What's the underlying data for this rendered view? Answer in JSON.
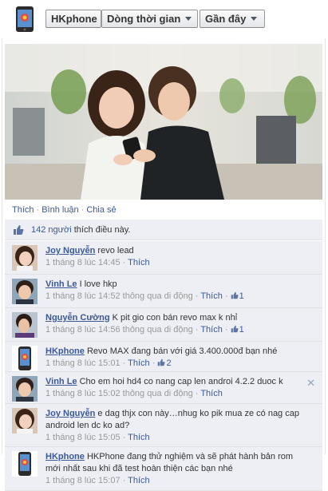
{
  "toolbar": {
    "page_name": "HKphone",
    "timeline_label": "Dòng thời gian",
    "recent_label": "Gần đây"
  },
  "post": {
    "actions": {
      "like": "Thích",
      "comment": "Bình luận",
      "share": "Chia sẻ",
      "separator": "·"
    },
    "likes": {
      "count_text": "142 người",
      "suffix": " thích điều này."
    }
  },
  "comments": [
    {
      "name": "Joy Nguyễn",
      "text": "revo lead",
      "time": "1 tháng 8 lúc 14:45",
      "via": "",
      "like_label": "Thích",
      "likes": ""
    },
    {
      "name": "Vinh Le",
      "text": "I love hkp",
      "time": "1 tháng 8 lúc 14:52",
      "via": "thông qua di động",
      "like_label": "Thích",
      "likes": "1"
    },
    {
      "name": "Nguyễn Cường",
      "text": "K pit gio con bán revo max k nhỉ",
      "time": "1 tháng 8 lúc 14:56",
      "via": "thông qua di động",
      "like_label": "Thích",
      "likes": "1"
    },
    {
      "name": "HKphone",
      "text": "Revo MAX đang bán với giá 3.400.000đ bạn nhé",
      "time": "1 tháng 8 lúc 15:01",
      "via": "",
      "like_label": "Thích",
      "likes": "2"
    },
    {
      "name": "Vinh Le",
      "text": "Cho em hoi hd4 co nang cap len androi 4.2.2 duoc k",
      "time": "1 tháng 8 lúc 15:02",
      "via": "thông qua di động",
      "like_label": "Thích",
      "likes": "",
      "close": "✕"
    },
    {
      "name": "Joy Nguyễn",
      "text": "e dag thjx con này…nhug ko pik mua ze có nag cap android len dc ko ad?",
      "time": "1 tháng 8 lúc 15:05",
      "via": "",
      "like_label": "Thích",
      "likes": ""
    },
    {
      "name": "HKphone",
      "text": "HKPhone đang thử nghiệm và sẽ phát hành bản rom mới nhất sau khi đã test hoàn thiện các bạn nhé",
      "time": "1 tháng 8 lúc 15:07",
      "via": "",
      "like_label": "Thích",
      "likes": ""
    }
  ],
  "colors": {
    "link": "#3b5998",
    "comment_bg": "#edeff4",
    "meta": "#999999"
  },
  "icons": {
    "like": "thumbs-up-icon",
    "close": "close-icon"
  }
}
